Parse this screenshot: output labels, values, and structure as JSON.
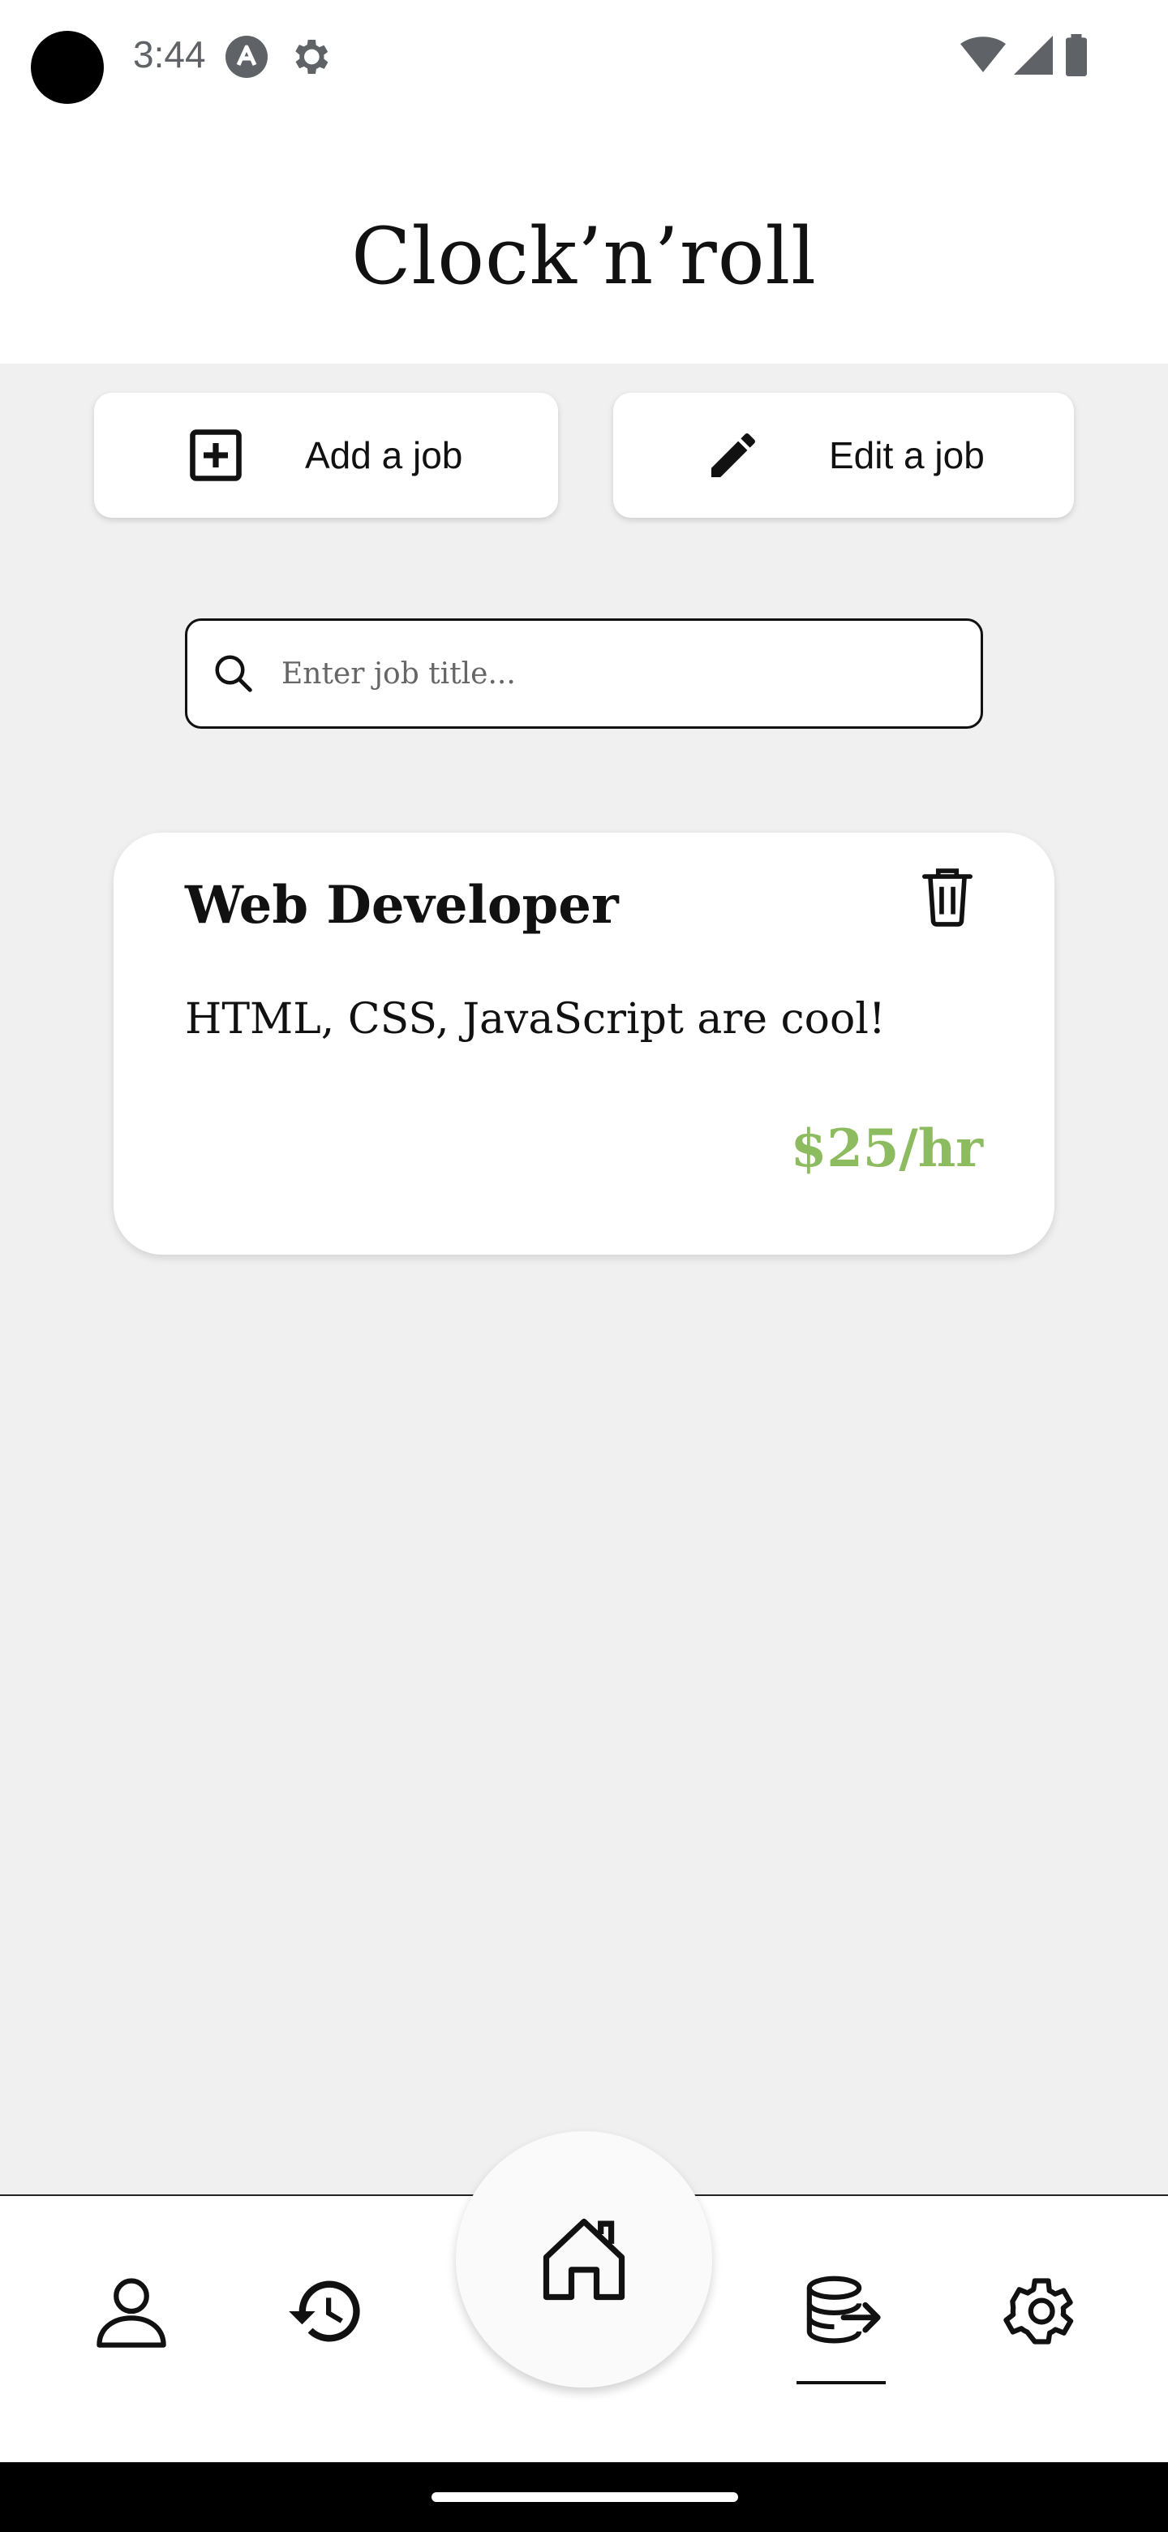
{
  "status_bar": {
    "time": "3:44",
    "left_icons": [
      "app-badge-icon",
      "settings-gear-icon"
    ],
    "right_icons": [
      "wifi-icon",
      "signal-icon",
      "battery-icon"
    ]
  },
  "header": {
    "title": "Clock’n’roll"
  },
  "actions": {
    "add_label": "Add a job",
    "edit_label": "Edit a job"
  },
  "search": {
    "placeholder": "Enter job title...",
    "value": ""
  },
  "jobs": [
    {
      "title": "Web Developer",
      "description": "HTML, CSS, JavaScript are cool!",
      "rate": "$25/hr"
    }
  ],
  "bottom_nav": {
    "items": [
      "profile-icon",
      "history-icon",
      "home-icon",
      "jobs-database-icon",
      "settings-icon"
    ],
    "active": "jobs-database-icon"
  },
  "colors": {
    "background": "#f0f0f0",
    "surface": "#ffffff",
    "rate": "#8dbb5f",
    "text": "#111111"
  }
}
